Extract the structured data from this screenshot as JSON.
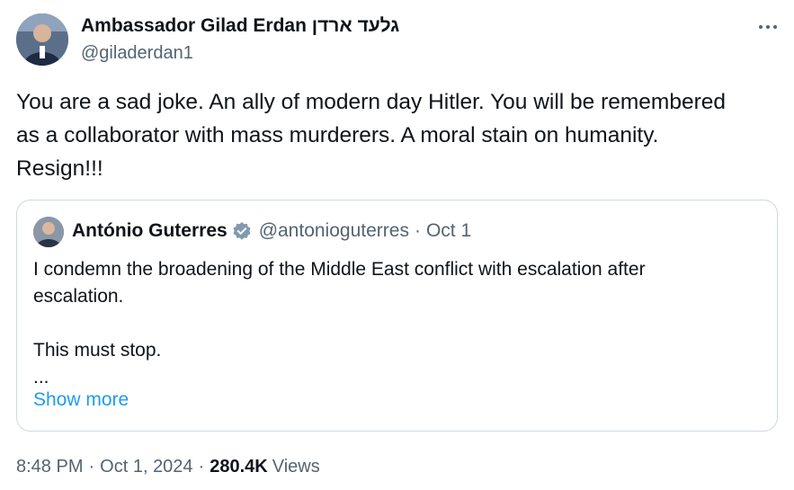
{
  "author": {
    "name": "Ambassador Gilad Erdan גלעד ארדן",
    "handle": "@giladerdan1"
  },
  "tweet": {
    "lines": [
      "You are a sad joke. An ally of modern day Hitler. You will be remembered",
      "as a collaborator with mass murderers. A moral stain on humanity.",
      "Resign!!!"
    ]
  },
  "quoted": {
    "name": "António Guterres",
    "handle": "@antonioguterres",
    "separator": "·",
    "date": "Oct 1",
    "lines": [
      "I condemn the broadening of the Middle East conflict with escalation after",
      "escalation.",
      "",
      "This must stop.",
      "..."
    ],
    "show_more": "Show more"
  },
  "meta": {
    "time": "8:48 PM",
    "sep1": "·",
    "date": "Oct 1, 2024",
    "sep2": "·",
    "views_count": "280.4K",
    "views_label": "Views"
  },
  "colors": {
    "text": "#0f1419",
    "secondary": "#536471",
    "link": "#1d9bf0",
    "border": "#cfd9de"
  },
  "icons": {
    "more": "more-icon",
    "verified": "verified-icon"
  }
}
